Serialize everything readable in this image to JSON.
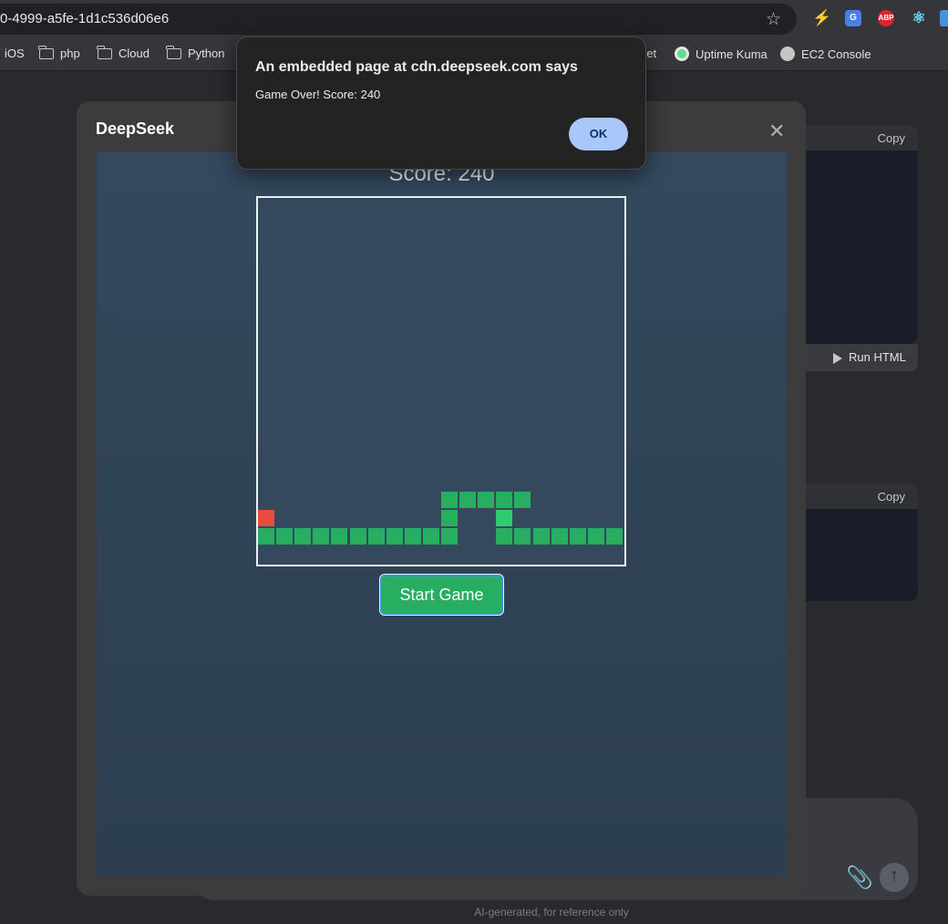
{
  "browser": {
    "url": "0-4999-a5fe-1d1c536d06e6",
    "extensions": [
      "bolt-extension-icon",
      "translate-extension-icon",
      "abp-extension-icon",
      "react-devtools-icon",
      "extension-icon"
    ],
    "abp_label": "ABP",
    "bookmarks": [
      {
        "label": "iOS",
        "icon": "none"
      },
      {
        "label": "php",
        "icon": "folder-icon"
      },
      {
        "label": "Cloud",
        "icon": "folder-icon"
      },
      {
        "label": "Python",
        "icon": "folder-icon"
      },
      {
        "label": "ret",
        "icon": "none"
      },
      {
        "label": "Uptime Kuma",
        "icon": "uptime-kuma-icon"
      },
      {
        "label": "EC2 Console",
        "icon": "globe-icon"
      }
    ]
  },
  "background": {
    "copy_label_1": "Copy",
    "copy_label_2": "Copy",
    "run_html_label": "Run HTML",
    "footnote": "AI-generated, for reference only"
  },
  "modal": {
    "title": "DeepSeek",
    "close_glyph": "✕"
  },
  "game": {
    "score_text": "Score: 240",
    "start_button_label": "Start Game",
    "colors": {
      "snake": "#27ae60",
      "snake_head": "#2ecc71",
      "food": "#e74c3c",
      "board_border": "#ecf0f1"
    },
    "grid_size": 20,
    "food": [
      0,
      17
    ],
    "head": [
      13,
      17
    ],
    "snake_body": [
      [
        0,
        18
      ],
      [
        1,
        18
      ],
      [
        2,
        18
      ],
      [
        3,
        18
      ],
      [
        4,
        18
      ],
      [
        5,
        18
      ],
      [
        6,
        18
      ],
      [
        7,
        18
      ],
      [
        8,
        18
      ],
      [
        9,
        18
      ],
      [
        10,
        18
      ],
      [
        10,
        17
      ],
      [
        10,
        16
      ],
      [
        11,
        16
      ],
      [
        12,
        16
      ],
      [
        13,
        16
      ],
      [
        14,
        16
      ],
      [
        13,
        18
      ],
      [
        14,
        18
      ],
      [
        15,
        18
      ],
      [
        16,
        18
      ],
      [
        17,
        18
      ],
      [
        18,
        18
      ],
      [
        19,
        18
      ]
    ]
  },
  "alert": {
    "title": "An embedded page at cdn.deepseek.com says",
    "message": "Game Over! Score: 240",
    "ok_label": "OK"
  }
}
